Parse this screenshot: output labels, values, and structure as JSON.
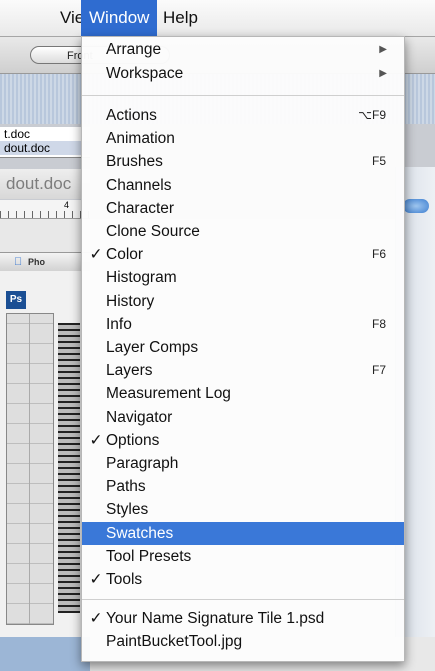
{
  "menubar": {
    "view": "View",
    "window": "Window",
    "help": "Help"
  },
  "background": {
    "front_button": "Front",
    "files": [
      "t.doc",
      "dout.doc"
    ],
    "doc_title": "dout.doc",
    "ruler_number": "4",
    "ps_title": "Pho",
    "ps_logo": "Ps"
  },
  "window_menu": {
    "arrange": {
      "label": "Arrange",
      "submenu": true
    },
    "workspace": {
      "label": "Workspace",
      "submenu": true
    },
    "items": [
      {
        "label": "Actions",
        "shortcut": "⌥F9",
        "checked": false
      },
      {
        "label": "Animation",
        "shortcut": "",
        "checked": false
      },
      {
        "label": "Brushes",
        "shortcut": "F5",
        "checked": false
      },
      {
        "label": "Channels",
        "shortcut": "",
        "checked": false
      },
      {
        "label": "Character",
        "shortcut": "",
        "checked": false
      },
      {
        "label": "Clone Source",
        "shortcut": "",
        "checked": false
      },
      {
        "label": "Color",
        "shortcut": "F6",
        "checked": true
      },
      {
        "label": "Histogram",
        "shortcut": "",
        "checked": false
      },
      {
        "label": "History",
        "shortcut": "",
        "checked": false
      },
      {
        "label": "Info",
        "shortcut": "F8",
        "checked": false
      },
      {
        "label": "Layer Comps",
        "shortcut": "",
        "checked": false
      },
      {
        "label": "Layers",
        "shortcut": "F7",
        "checked": false
      },
      {
        "label": "Measurement Log",
        "shortcut": "",
        "checked": false
      },
      {
        "label": "Navigator",
        "shortcut": "",
        "checked": false
      },
      {
        "label": "Options",
        "shortcut": "",
        "checked": true
      },
      {
        "label": "Paragraph",
        "shortcut": "",
        "checked": false
      },
      {
        "label": "Paths",
        "shortcut": "",
        "checked": false
      },
      {
        "label": "Styles",
        "shortcut": "",
        "checked": false
      },
      {
        "label": "Swatches",
        "shortcut": "",
        "checked": false,
        "highlighted": true
      },
      {
        "label": "Tool Presets",
        "shortcut": "",
        "checked": false
      },
      {
        "label": "Tools",
        "shortcut": "",
        "checked": true
      }
    ],
    "documents": [
      {
        "label": "Your Name Signature Tile 1.psd",
        "checked": true
      },
      {
        "label": "PaintBucketTool.jpg",
        "checked": false
      }
    ],
    "check_glyph": "✓",
    "arrow_glyph": "▶"
  },
  "colors": {
    "accent": "#3a78d8",
    "menubar_highlight": "#2f6cd0"
  }
}
